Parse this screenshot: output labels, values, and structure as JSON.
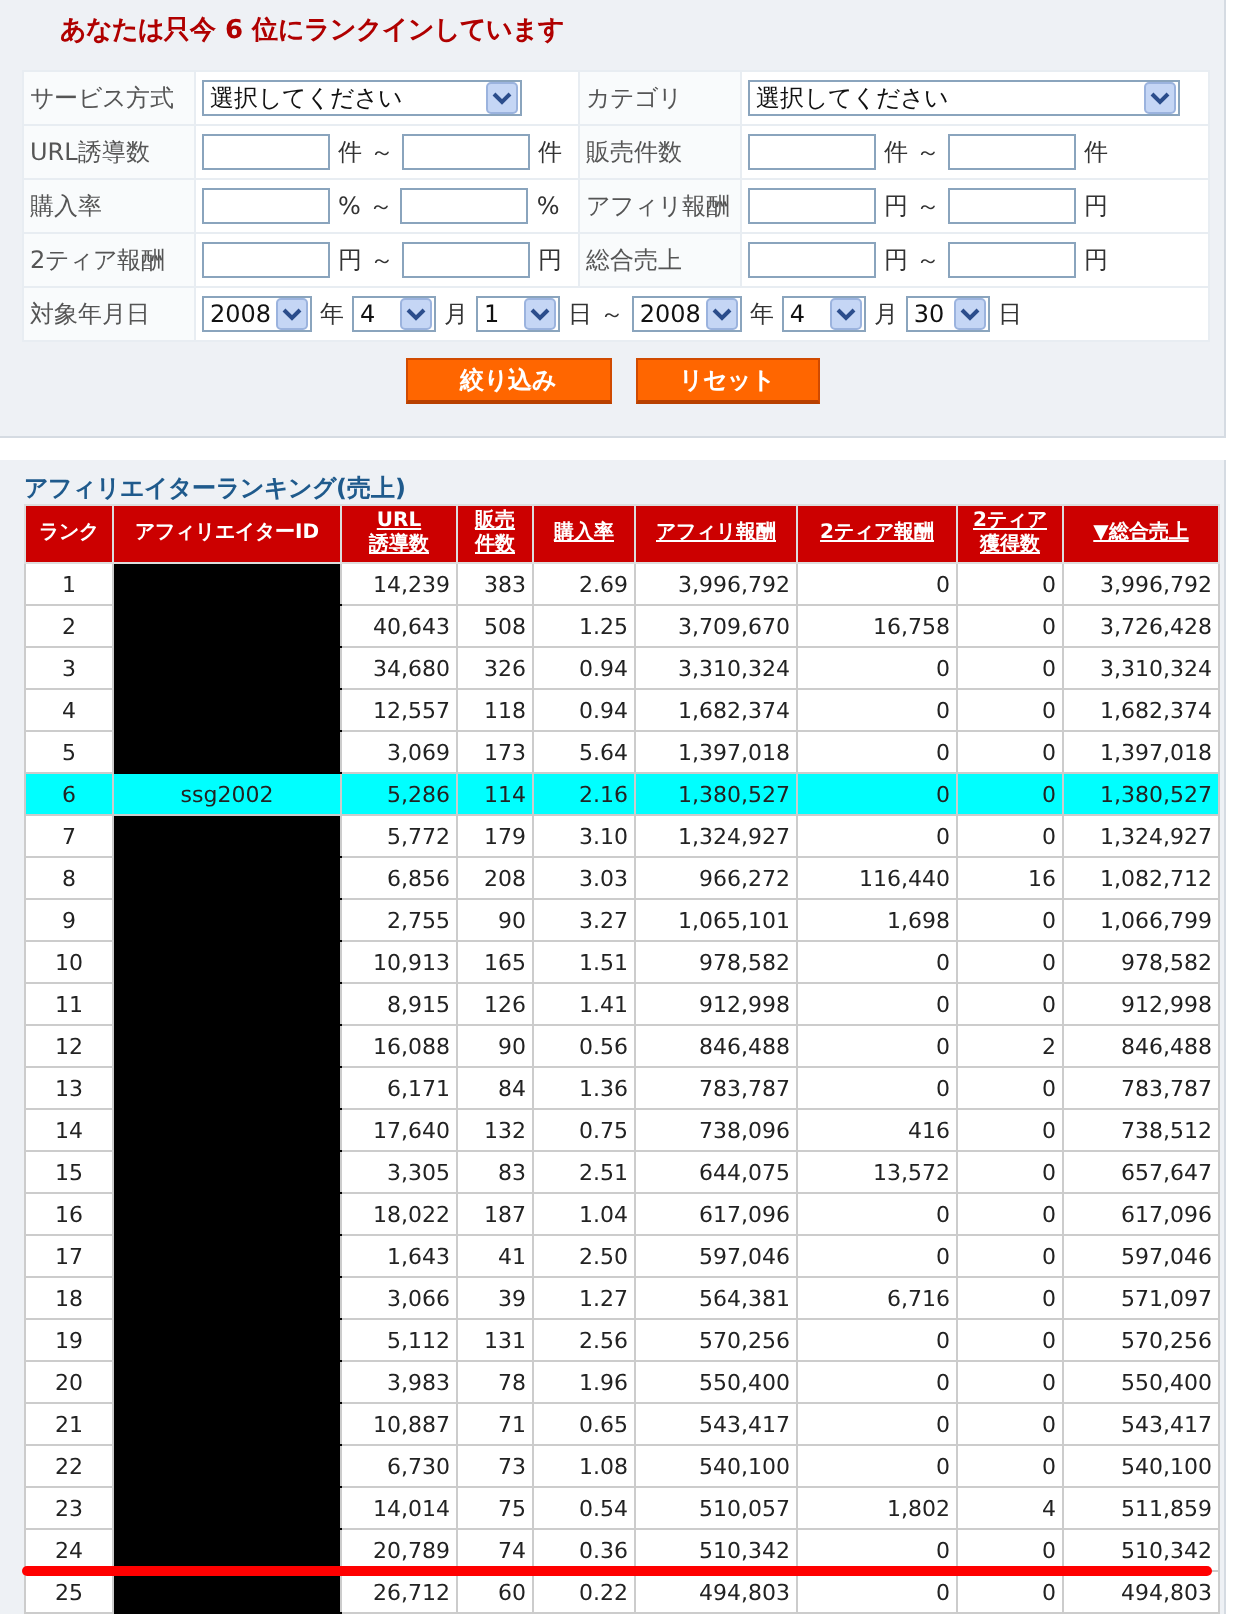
{
  "notice": "あなたは只今 6 位にランクインしています",
  "form": {
    "rows": [
      {
        "cells": [
          {
            "label": "サービス方式",
            "kind": "select",
            "value": "選択してください"
          },
          {
            "label": "カテゴリ",
            "kind": "select",
            "value": "選択してください"
          }
        ]
      },
      {
        "cells": [
          {
            "label": "URL誘導数",
            "kind": "range",
            "unit_from": "件",
            "tilde": "～",
            "unit_to": "件"
          },
          {
            "label": "販売件数",
            "kind": "range",
            "unit_from": "件",
            "tilde": "～",
            "unit_to": "件"
          }
        ]
      },
      {
        "cells": [
          {
            "label": "購入率",
            "kind": "range",
            "unit_from": "%",
            "tilde": "～",
            "unit_to": "%"
          },
          {
            "label": "アフィリ報酬",
            "kind": "range",
            "unit_from": "円",
            "tilde": "～",
            "unit_to": "円"
          }
        ]
      },
      {
        "cells": [
          {
            "label": "2ティア報酬",
            "kind": "range",
            "unit_from": "円",
            "tilde": "～",
            "unit_to": "円"
          },
          {
            "label": "総合売上",
            "kind": "range",
            "unit_from": "円",
            "tilde": "～",
            "unit_to": "円"
          }
        ]
      },
      {
        "cells": [
          {
            "label": "対象年月日",
            "kind": "date",
            "parts": [
              {
                "kind": "select",
                "value": "2008"
              },
              {
                "kind": "text",
                "text": "年"
              },
              {
                "kind": "select",
                "value": "4"
              },
              {
                "kind": "text",
                "text": "月"
              },
              {
                "kind": "select",
                "value": "1"
              },
              {
                "kind": "text",
                "text": "日 ～"
              },
              {
                "kind": "select",
                "value": "2008"
              },
              {
                "kind": "text",
                "text": "年"
              },
              {
                "kind": "select",
                "value": "4"
              },
              {
                "kind": "text",
                "text": "月"
              },
              {
                "kind": "select",
                "value": "30"
              },
              {
                "kind": "text",
                "text": "日"
              }
            ]
          }
        ]
      }
    ]
  },
  "buttons": [
    "絞り込み",
    "リセット"
  ],
  "ranking": {
    "title": "アフィリエイターランキング(売上)",
    "columns": [
      {
        "label": "ランク",
        "link": false
      },
      {
        "label": "アフィリエイターID",
        "link": false
      },
      {
        "label": "URL誘導数",
        "link": true
      },
      {
        "label": "販売件数",
        "link": true
      },
      {
        "label": "購入率",
        "link": true
      },
      {
        "label": "アフィリ報酬",
        "link": true
      },
      {
        "label": "2ティア報酬",
        "link": true
      },
      {
        "label": "2ティア獲得数",
        "link": true
      },
      {
        "label": "▼総合売上",
        "link": true
      }
    ],
    "rows": [
      {
        "redacted": true,
        "cells": [
          "1",
          "",
          "14,239",
          "383",
          "2.69",
          "3,996,792",
          "0",
          "0",
          "3,996,792"
        ]
      },
      {
        "redacted": true,
        "cells": [
          "2",
          "",
          "40,643",
          "508",
          "1.25",
          "3,709,670",
          "16,758",
          "0",
          "3,726,428"
        ]
      },
      {
        "redacted": true,
        "cells": [
          "3",
          "",
          "34,680",
          "326",
          "0.94",
          "3,310,324",
          "0",
          "0",
          "3,310,324"
        ]
      },
      {
        "redacted": true,
        "cells": [
          "4",
          "",
          "12,557",
          "118",
          "0.94",
          "1,682,374",
          "0",
          "0",
          "1,682,374"
        ]
      },
      {
        "redacted": true,
        "cells": [
          "5",
          "",
          "3,069",
          "173",
          "5.64",
          "1,397,018",
          "0",
          "0",
          "1,397,018"
        ]
      },
      {
        "redacted": false,
        "selected": true,
        "cells": [
          "6",
          "ssg2002",
          "5,286",
          "114",
          "2.16",
          "1,380,527",
          "0",
          "0",
          "1,380,527"
        ]
      },
      {
        "redacted": true,
        "cells": [
          "7",
          "",
          "5,772",
          "179",
          "3.10",
          "1,324,927",
          "0",
          "0",
          "1,324,927"
        ]
      },
      {
        "redacted": true,
        "cells": [
          "8",
          "",
          "6,856",
          "208",
          "3.03",
          "966,272",
          "116,440",
          "16",
          "1,082,712"
        ]
      },
      {
        "redacted": true,
        "cells": [
          "9",
          "",
          "2,755",
          "90",
          "3.27",
          "1,065,101",
          "1,698",
          "0",
          "1,066,799"
        ]
      },
      {
        "redacted": true,
        "cells": [
          "10",
          "",
          "10,913",
          "165",
          "1.51",
          "978,582",
          "0",
          "0",
          "978,582"
        ]
      },
      {
        "redacted": true,
        "cells": [
          "11",
          "",
          "8,915",
          "126",
          "1.41",
          "912,998",
          "0",
          "0",
          "912,998"
        ]
      },
      {
        "redacted": true,
        "cells": [
          "12",
          "",
          "16,088",
          "90",
          "0.56",
          "846,488",
          "0",
          "2",
          "846,488"
        ]
      },
      {
        "redacted": true,
        "cells": [
          "13",
          "",
          "6,171",
          "84",
          "1.36",
          "783,787",
          "0",
          "0",
          "783,787"
        ]
      },
      {
        "redacted": true,
        "cells": [
          "14",
          "",
          "17,640",
          "132",
          "0.75",
          "738,096",
          "416",
          "0",
          "738,512"
        ]
      },
      {
        "redacted": true,
        "cells": [
          "15",
          "",
          "3,305",
          "83",
          "2.51",
          "644,075",
          "13,572",
          "0",
          "657,647"
        ]
      },
      {
        "redacted": true,
        "cells": [
          "16",
          "",
          "18,022",
          "187",
          "1.04",
          "617,096",
          "0",
          "0",
          "617,096"
        ]
      },
      {
        "redacted": true,
        "cells": [
          "17",
          "",
          "1,643",
          "41",
          "2.50",
          "597,046",
          "0",
          "0",
          "597,046"
        ]
      },
      {
        "redacted": true,
        "cells": [
          "18",
          "",
          "3,066",
          "39",
          "1.27",
          "564,381",
          "6,716",
          "0",
          "571,097"
        ]
      },
      {
        "redacted": true,
        "cells": [
          "19",
          "",
          "5,112",
          "131",
          "2.56",
          "570,256",
          "0",
          "0",
          "570,256"
        ]
      },
      {
        "redacted": true,
        "cells": [
          "20",
          "",
          "3,983",
          "78",
          "1.96",
          "550,400",
          "0",
          "0",
          "550,400"
        ]
      },
      {
        "redacted": true,
        "cells": [
          "21",
          "",
          "10,887",
          "71",
          "0.65",
          "543,417",
          "0",
          "0",
          "543,417"
        ]
      },
      {
        "redacted": true,
        "cells": [
          "22",
          "",
          "6,730",
          "73",
          "1.08",
          "540,100",
          "0",
          "0",
          "540,100"
        ]
      },
      {
        "redacted": true,
        "cells": [
          "23",
          "",
          "14,014",
          "75",
          "0.54",
          "510,057",
          "1,802",
          "4",
          "511,859"
        ]
      },
      {
        "redacted": true,
        "marked_below": true,
        "cells": [
          "24",
          "",
          "20,789",
          "74",
          "0.36",
          "510,342",
          "0",
          "0",
          "510,342"
        ]
      },
      {
        "redacted": true,
        "cells": [
          "25",
          "",
          "26,712",
          "60",
          "0.22",
          "494,803",
          "0",
          "0",
          "494,803"
        ]
      }
    ]
  }
}
